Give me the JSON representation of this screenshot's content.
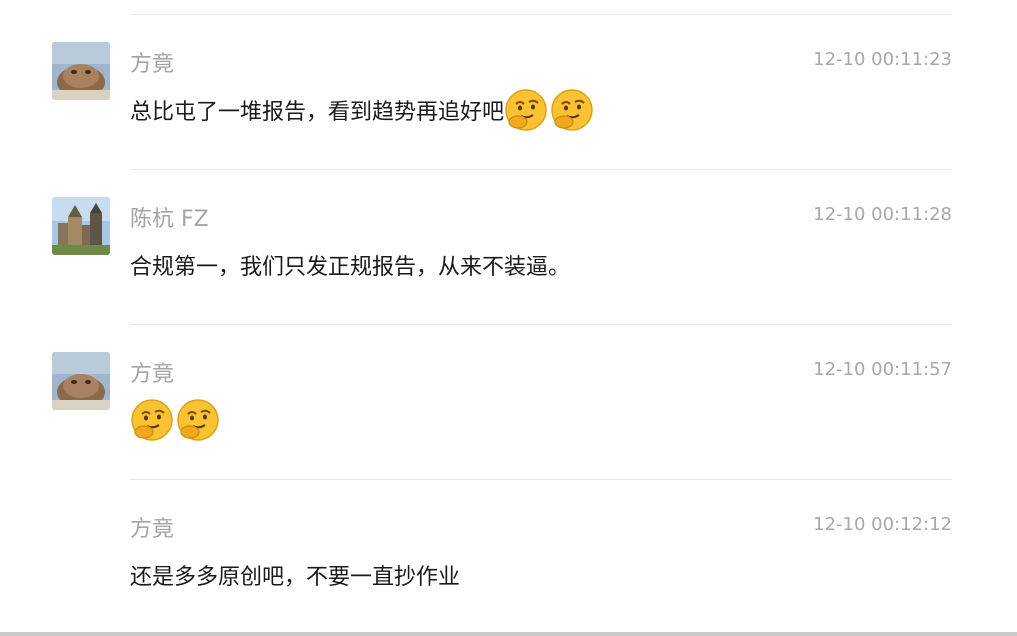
{
  "messages": [
    {
      "sender": "方竟",
      "time": "12-10 00:11:23",
      "text": "总比屯了一堆报告，看到趋势再追好吧",
      "emojis": [
        "thinking-face-icon",
        "thinking-face-icon"
      ],
      "avatar": "cat-avatar"
    },
    {
      "sender": "陈杭 FZ",
      "time": "12-10 00:11:28",
      "text": "合规第一，我们只发正规报告，从来不装逼。",
      "emojis": [],
      "avatar": "castle-avatar"
    },
    {
      "sender": "方竟",
      "time": "12-10 00:11:57",
      "text": "",
      "emojis": [
        "thinking-face-icon",
        "thinking-face-icon"
      ],
      "avatar": "cat-avatar"
    },
    {
      "sender": "方竟",
      "time": "12-10 00:12:12",
      "text": "还是多多原创吧，不要一直抄作业",
      "emojis": [],
      "avatar": ""
    }
  ],
  "colors": {
    "sender": "#a4a4a4",
    "time": "#a8a8a8",
    "text": "#1a1a1a",
    "divider": "#e6e6e6"
  }
}
